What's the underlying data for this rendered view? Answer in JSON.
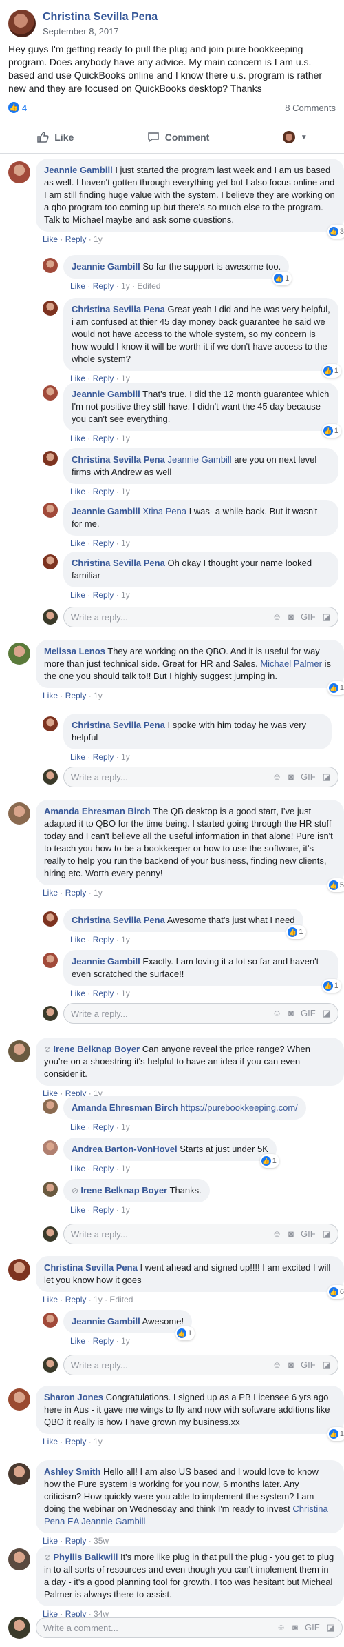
{
  "post": {
    "author": "Christina Sevilla Pena",
    "date": "September 8, 2017",
    "text": "Hey guys I'm getting ready to pull the plug and join pure bookkeeping program. Does anybody have any advice. My main concern is I am u.s. based and use QuickBooks online and I know there u.s. program is rather new and they are focused on QuickBooks desktop? Thanks",
    "like_count": "4",
    "comment_count": "8 Comments",
    "like_label": "Like",
    "comment_label": "Comment"
  },
  "comments": [
    {
      "name": "Jeannie Gambill",
      "text": "I just started the program last week and I am us based as well. I haven't gotten through everything yet but I also focus online and I am still finding huge value with the system. I believe they are working on a qbo program too coming up but there's so much else to the program. Talk to Michael maybe and ask some questions.",
      "like": "Like",
      "reply": "Reply",
      "time": "1y",
      "reacts": "3"
    },
    {
      "name": "Jeannie Gambill",
      "text": "So far the support is awesome too.",
      "like": "Like",
      "reply": "Reply",
      "time": "1y",
      "edited": "Edited",
      "reacts": "1"
    },
    {
      "name": "Christina Sevilla Pena",
      "text": "Great yeah I did and he was very helpful, i am confused at thier 45 day money back guarantee he said we would not have access to the whole system, so my concern is how would I know it will be worth it if we don't have access to the whole system?",
      "like": "Like",
      "reply": "Reply",
      "time": "1y",
      "reacts": "1"
    },
    {
      "name": "Jeannie Gambill",
      "text": "That's true. I did the 12 month guarantee which I'm not positive they still have. I didn't want the 45 day because you can't see everything.",
      "like": "Like",
      "reply": "Reply",
      "time": "1y",
      "reacts": "1"
    },
    {
      "name": "Christina Sevilla Pena",
      "tag": "Jeannie Gambill",
      "text": "are you on next level firms with Andrew as well",
      "like": "Like",
      "reply": "Reply",
      "time": "1y"
    },
    {
      "name": "Jeannie Gambill",
      "tag": "Xtina Pena",
      "text": "I was- a while back. But it wasn't for me.",
      "like": "Like",
      "reply": "Reply",
      "time": "1y"
    },
    {
      "name": "Christina Sevilla Pena",
      "text": "Oh okay I thought your name looked familiar",
      "like": "Like",
      "reply": "Reply",
      "time": "1y"
    },
    {
      "name": "Melissa Lenos",
      "text": "They are working on the QBO. And it is useful for way more than just technical side. Great for HR and Sales.",
      "tag2": "Michael Palmer",
      "text2": "is the one you should talk to!! But I highly suggest jumping in.",
      "like": "Like",
      "reply": "Reply",
      "time": "1y",
      "reacts": "1"
    },
    {
      "name": "Christina Sevilla Pena",
      "text": "I spoke with him today he was very helpful",
      "like": "Like",
      "reply": "Reply",
      "time": "1y"
    },
    {
      "name": "Amanda Ehresman Birch",
      "text": "The QB desktop is a good start, I've just adapted it to QBO for the time being. I started going through the HR stuff today and I can't believe all the useful information in that alone! Pure isn't to teach you how to be a bookkeeper or how to use the software, it's really to help you run the backend of your business, finding new clients, hiring etc. Worth every penny!",
      "like": "Like",
      "reply": "Reply",
      "time": "1y",
      "reacts": "5"
    },
    {
      "name": "Christina Sevilla Pena",
      "text": "Awesome that's just what I need",
      "like": "Like",
      "reply": "Reply",
      "time": "1y",
      "reacts": "1"
    },
    {
      "name": "Jeannie Gambill",
      "text": "Exactly. I am loving it a lot so far and haven't even scratched the surface!!",
      "like": "Like",
      "reply": "Reply",
      "time": "1y",
      "reacts": "1"
    },
    {
      "name": "Irene Belknap Boyer",
      "text": "Can anyone reveal the price range? When you're on a shoestring it's helpful to have an idea if you can even consider it.",
      "like": "Like",
      "reply": "Reply",
      "time": "1y"
    },
    {
      "name": "Amanda Ehresman Birch",
      "link": "https://purebookkeeping.com/",
      "like": "Like",
      "reply": "Reply",
      "time": "1y"
    },
    {
      "name": "Andrea Barton-VonHovel",
      "text": "Starts at just under 5K",
      "like": "Like",
      "reply": "Reply",
      "time": "1y",
      "reacts": "1"
    },
    {
      "name": "Irene Belknap Boyer",
      "text": "Thanks.",
      "like": "Like",
      "reply": "Reply",
      "time": "1y"
    },
    {
      "name": "Christina Sevilla Pena",
      "text": "I went ahead and signed up!!!! I am excited I will let you know how it goes",
      "like": "Like",
      "reply": "Reply",
      "time": "1y",
      "edited": "Edited",
      "reacts": "6"
    },
    {
      "name": "Jeannie Gambill",
      "text": "Awesome!",
      "like": "Like",
      "reply": "Reply",
      "time": "1y",
      "reacts": "1"
    },
    {
      "name": "Sharon Jones",
      "text": "Congratulations. I signed up as a PB Licensee 6 yrs ago here in Aus - it gave me wings to fly and now with software additions like QBO it really is how I have grown my business.xx",
      "like": "Like",
      "reply": "Reply",
      "time": "1y",
      "reacts": "1"
    },
    {
      "name": "Ashley Smith",
      "text": "Hello all! I am also US based and I would love to know how the Pure system is working for you now, 6 months later. Any criticism? How quickly were you able to implement the system? I am doing the webinar on Wednesday and think I'm ready to invest",
      "tag2": "Christina Pena EA",
      "tag3": "Jeannie Gambill",
      "like": "Like",
      "reply": "Reply",
      "time": "35w"
    },
    {
      "name": "Phyllis Balkwill",
      "text": "It's more like plug in that pull the plug - you get to plug in to all sorts of resources and even though you can't implement them in a day - it's a good planning tool for growth. I too was hesitant but Micheal Palmer is always there to assist.",
      "like": "Like",
      "reply": "Reply",
      "time": "34w"
    }
  ],
  "reply_placeholder": "Write a reply...",
  "comment_placeholder": "Write a comment...",
  "colors": {
    "link": "#385898",
    "bubble": "#f0f2f5",
    "like": "#1877f2"
  }
}
